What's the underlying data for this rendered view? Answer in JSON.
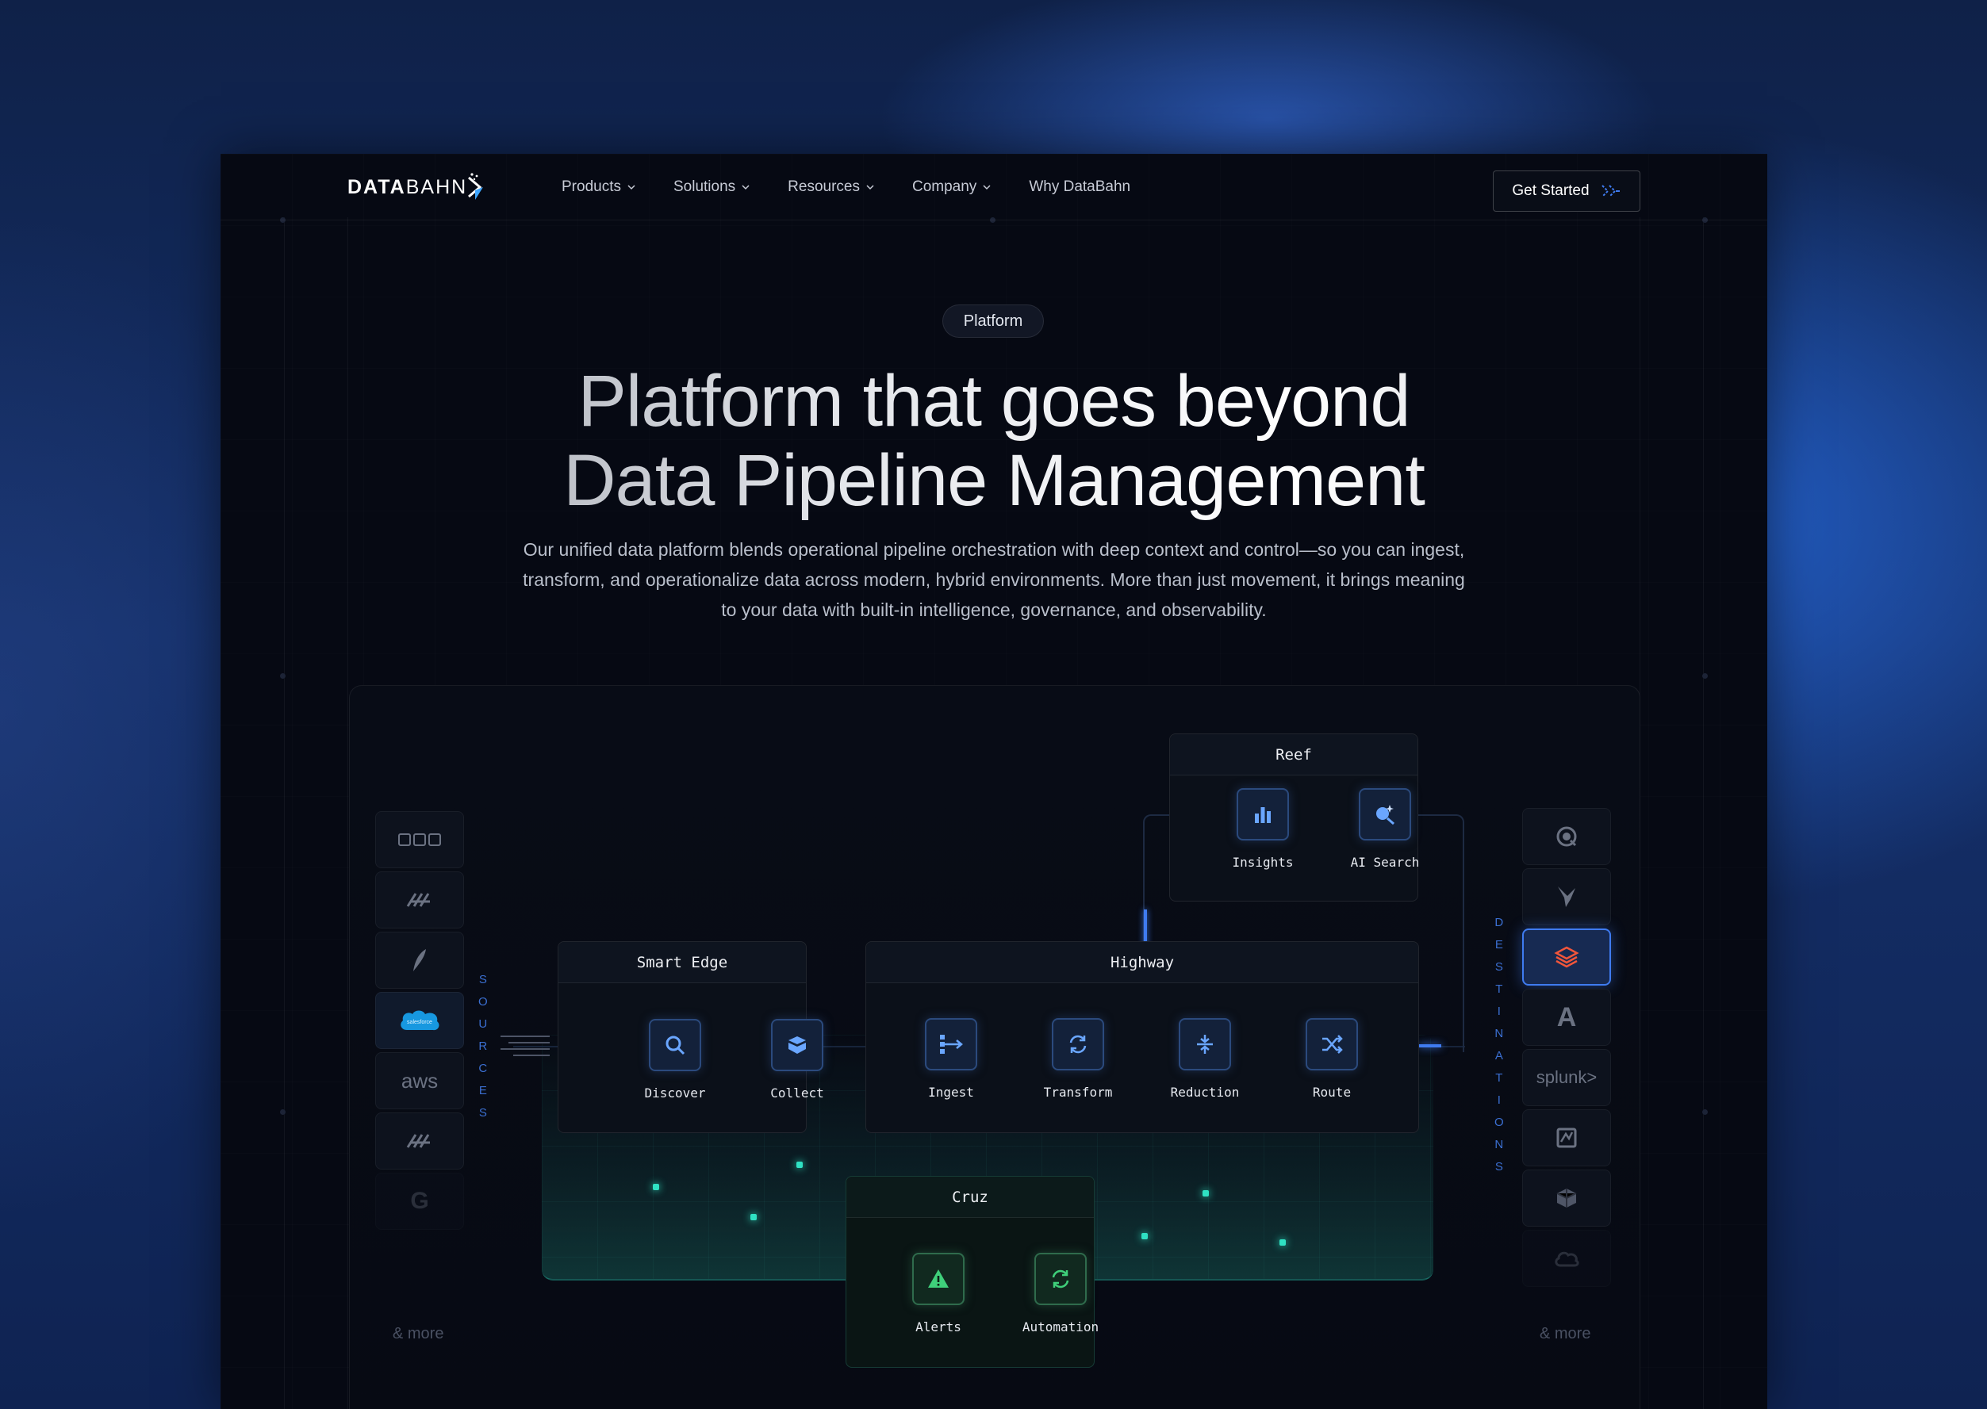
{
  "brand": {
    "name_bold": "DATA",
    "name_thin": "BAHN"
  },
  "nav": {
    "items": [
      {
        "label": "Products",
        "has_menu": true
      },
      {
        "label": "Solutions",
        "has_menu": true
      },
      {
        "label": "Resources",
        "has_menu": true
      },
      {
        "label": "Company",
        "has_menu": true
      },
      {
        "label": "Why DataBahn",
        "has_menu": false
      }
    ],
    "cta": "Get Started"
  },
  "hero": {
    "badge": "Platform",
    "title_line1": "Platform that goes beyond",
    "title_line2": "Data Pipeline Management",
    "subtitle": "Our unified data platform blends operational pipeline orchestration with deep context and control—so you can ingest, transform, and operationalize data across modern, hybrid environments. More than just movement, it brings meaning to your data with built-in intelligence, governance, and observability."
  },
  "diagram": {
    "sources_label": "SOURCES",
    "destinations_label": "DESTINATIONS",
    "sources_more": "& more",
    "destinations_more": "& more",
    "sources": [
      {
        "icon": "cloud-storage-icon"
      },
      {
        "icon": "paloalto-icon"
      },
      {
        "icon": "feather-icon"
      },
      {
        "icon": "salesforce-icon",
        "label": "salesforce"
      },
      {
        "icon": "aws-icon",
        "label": "aws"
      },
      {
        "icon": "paloalto-icon"
      },
      {
        "icon": "google-icon",
        "label": "G"
      }
    ],
    "destinations": [
      {
        "icon": "search-circle-icon"
      },
      {
        "icon": "bird-icon"
      },
      {
        "icon": "stack-layers-icon"
      },
      {
        "icon": "azure-icon",
        "label": "A"
      },
      {
        "icon": "splunk-icon",
        "label": "splunk>"
      },
      {
        "icon": "map-icon"
      },
      {
        "icon": "cube-icon"
      },
      {
        "icon": "cloud-icon"
      }
    ],
    "panels": {
      "smart_edge": {
        "title": "Smart Edge",
        "nodes": [
          "Discover",
          "Collect"
        ]
      },
      "highway": {
        "title": "Highway",
        "nodes": [
          "Ingest",
          "Transform",
          "Reduction",
          "Route"
        ]
      },
      "reef": {
        "title": "Reef",
        "nodes": [
          "Insights",
          "AI Search"
        ]
      },
      "cruz": {
        "title": "Cruz",
        "nodes": [
          "Alerts",
          "Automation"
        ]
      }
    }
  },
  "colors": {
    "accent": "#3f7bf0",
    "green": "#2fe1c3",
    "bg": "#060913"
  }
}
